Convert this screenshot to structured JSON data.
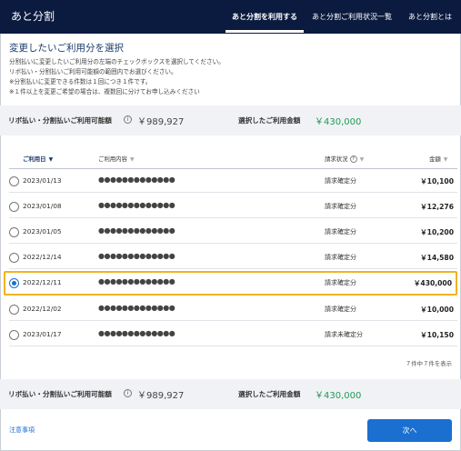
{
  "header": {
    "title": "あと分割",
    "tabs": [
      {
        "label": "あと分割を利用する",
        "active": true
      },
      {
        "label": "あと分割ご利用状況一覧",
        "active": false
      },
      {
        "label": "あと分割とは",
        "active": false
      }
    ]
  },
  "intro": {
    "title": "変更したいご利用分を選択",
    "lines": [
      "分割払いに変更したいご利用分の左端のチェックボックスを選択してください。",
      "リボ払い・分割払いご利用可能額の範囲内でお選びください。",
      "※分割払いに変更できる件数は１回につき１件です。",
      "※１件以上を変更ご希望の場合は、複数回に分けてお申し込みください"
    ]
  },
  "summary": {
    "available_label": "リボ払い・分割払いご利用可能額",
    "info_glyph": "i",
    "available_value": "￥989,927",
    "selected_label": "選択したご利用金額",
    "selected_value": "￥430,000"
  },
  "table": {
    "headers": {
      "date": "ご利用日",
      "date_sort": "▼",
      "detail": "ご利用内容",
      "status": "請求状況",
      "status_info": "?",
      "amount": "金額",
      "caret": "▼"
    },
    "rows": [
      {
        "date": "2023/01/13",
        "detail": "●●●●●●●●●●●●●",
        "status": "請求確定分",
        "amount": "￥10,100",
        "selected": false
      },
      {
        "date": "2023/01/08",
        "detail": "●●●●●●●●●●●●●",
        "status": "請求確定分",
        "amount": "￥12,276",
        "selected": false
      },
      {
        "date": "2023/01/05",
        "detail": "●●●●●●●●●●●●●",
        "status": "請求確定分",
        "amount": "￥10,200",
        "selected": false
      },
      {
        "date": "2022/12/14",
        "detail": "●●●●●●●●●●●●●",
        "status": "請求確定分",
        "amount": "￥14,580",
        "selected": false
      },
      {
        "date": "2022/12/11",
        "detail": "●●●●●●●●●●●●●",
        "status": "請求確定分",
        "amount": "￥430,000",
        "selected": true
      },
      {
        "date": "2022/12/02",
        "detail": "●●●●●●●●●●●●●",
        "status": "請求確定分",
        "amount": "￥10,000",
        "selected": false
      },
      {
        "date": "2023/01/17",
        "detail": "●●●●●●●●●●●●●",
        "status": "請求未確定分",
        "amount": "￥10,150",
        "selected": false
      }
    ],
    "pager": "７件中７件を表示"
  },
  "footer": {
    "notes_link": "注意事項",
    "next_button": "次へ"
  },
  "colors": {
    "header_bg": "#0b1b3f",
    "accent_blue": "#1a6fd1",
    "selected_border": "#f0b323",
    "amount_green": "#1f9b55"
  }
}
